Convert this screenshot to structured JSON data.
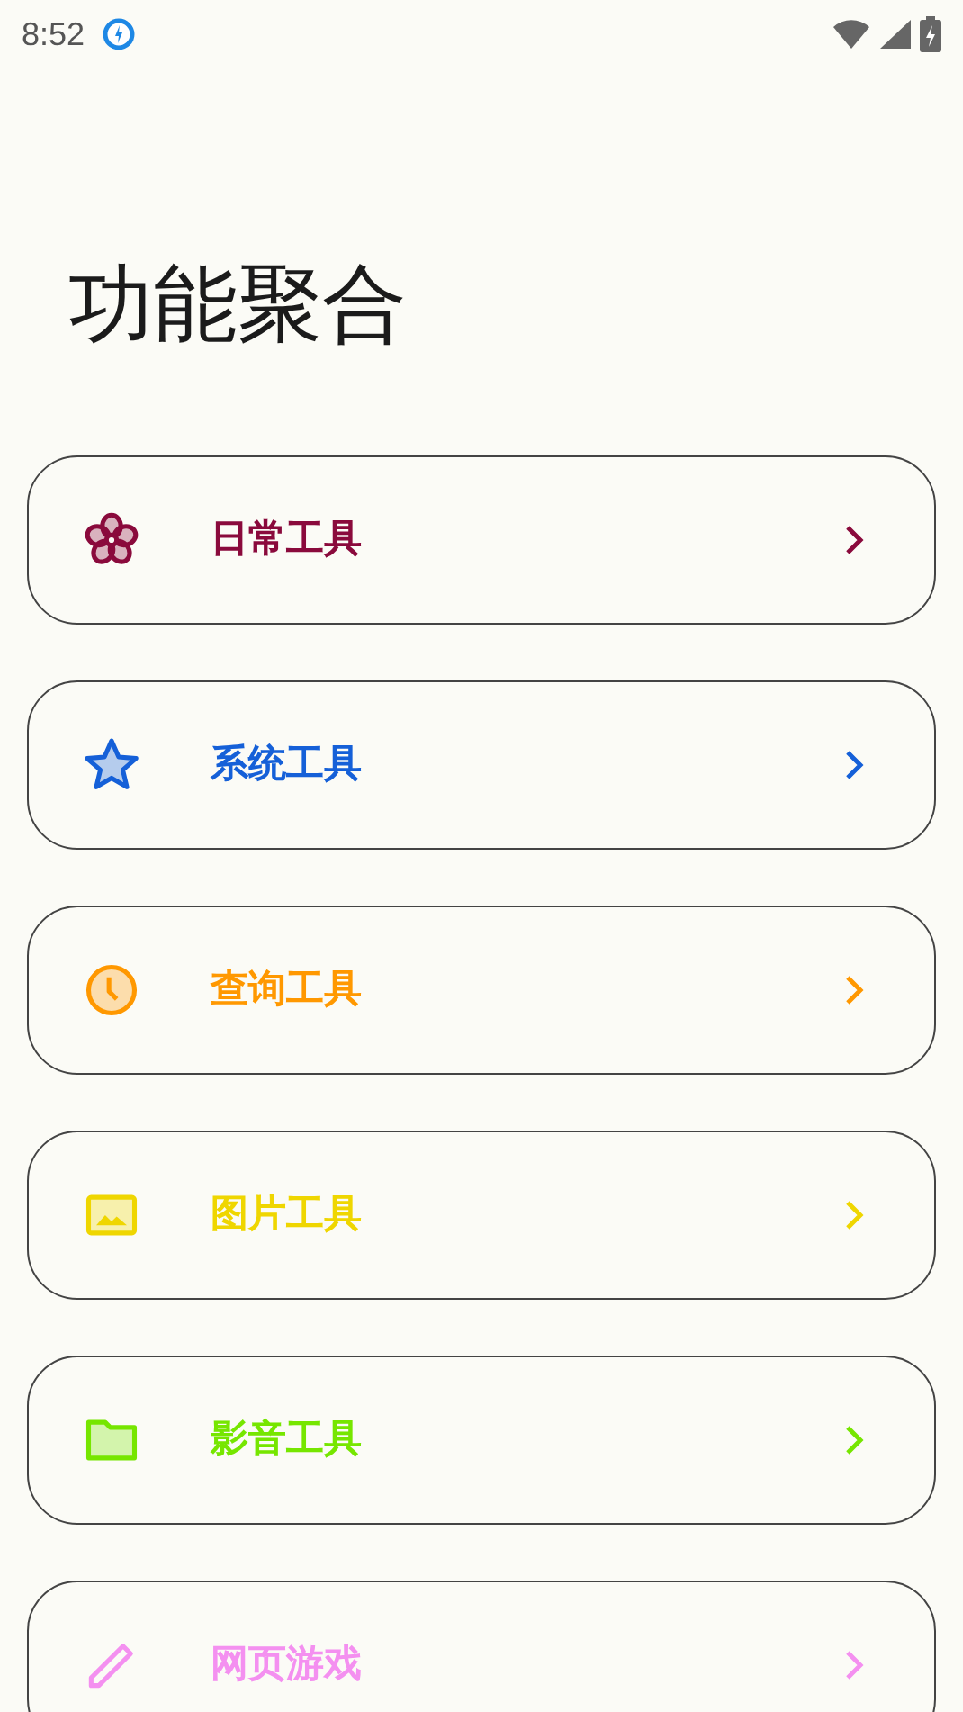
{
  "status_bar": {
    "time": "8:52"
  },
  "title": "功能聚合",
  "items": [
    {
      "label": "日常工具",
      "kind": "flower",
      "color": "#8a0a3c"
    },
    {
      "label": "系统工具",
      "kind": "star",
      "color": "#1560d8"
    },
    {
      "label": "查询工具",
      "kind": "clock",
      "color": "#ff9800"
    },
    {
      "label": "图片工具",
      "kind": "image",
      "color": "#efd600"
    },
    {
      "label": "影音工具",
      "kind": "folder",
      "color": "#76e600"
    },
    {
      "label": "网页游戏",
      "kind": "pencil",
      "color": "#f490f0"
    }
  ]
}
